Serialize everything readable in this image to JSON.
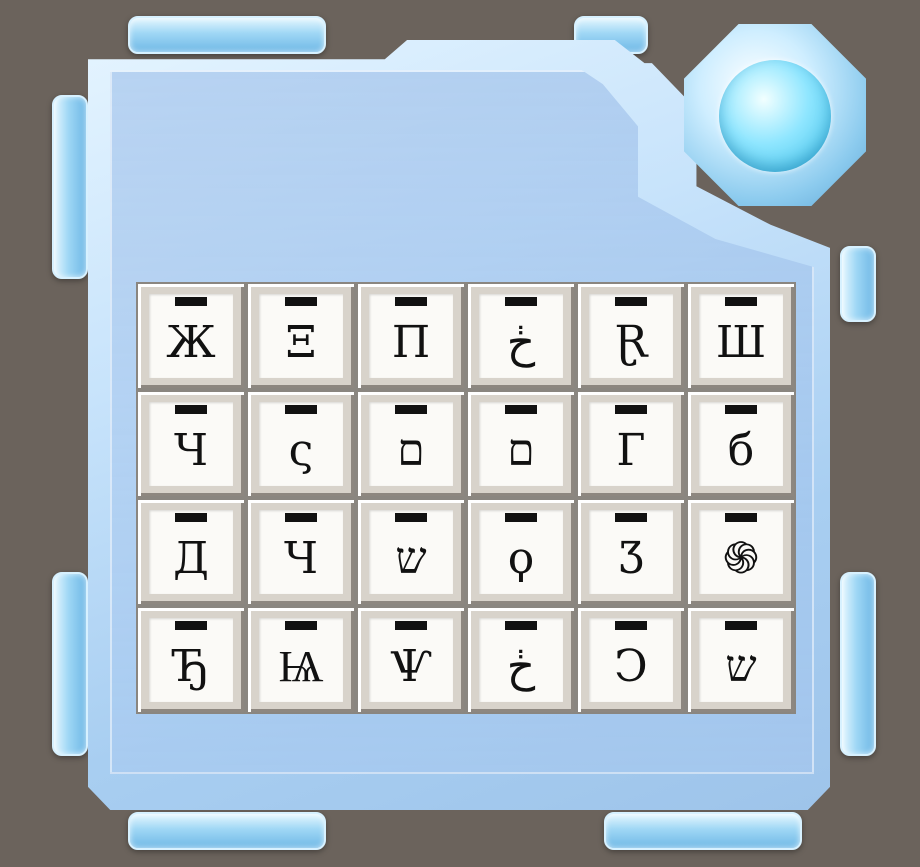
{
  "module": {
    "keys": [
      [
        "Ж",
        "Ξ",
        "П",
        "ڂ",
        "Ɽ",
        "Ш"
      ],
      [
        "Ч",
        "ς",
        "ם",
        "ם",
        "Г",
        "б"
      ],
      [
        "Д",
        "Ч",
        "ש",
        "ϙ",
        "Ʒ",
        "֍"
      ],
      [
        "Ђ",
        "Ѩ",
        "Ѱ",
        "ڂ",
        "Ͻ",
        "ש"
      ]
    ]
  }
}
